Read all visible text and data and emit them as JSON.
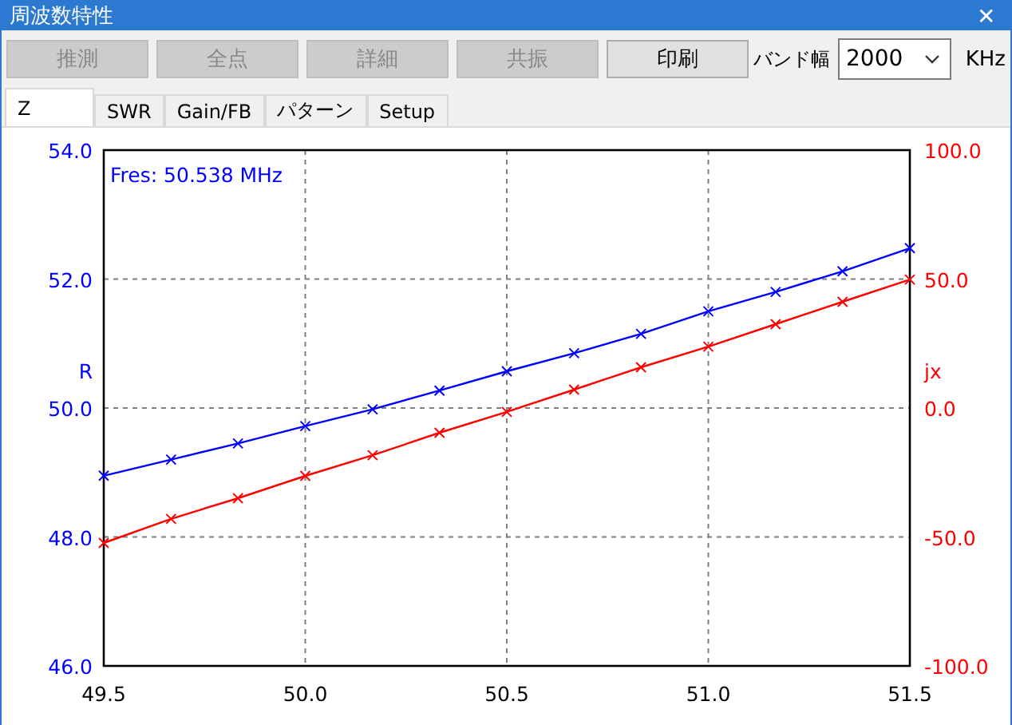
{
  "window": {
    "title": "周波数特性",
    "close": "✕"
  },
  "toolbar": {
    "buttons": [
      {
        "label": "推測",
        "disabled": true
      },
      {
        "label": "全点",
        "disabled": true
      },
      {
        "label": "詳細",
        "disabled": true
      },
      {
        "label": "共振",
        "disabled": true
      },
      {
        "label": "印刷",
        "disabled": false
      }
    ],
    "bandwidth": {
      "label": "バンド幅",
      "value": "2000",
      "unit": "KHz"
    }
  },
  "tabs": [
    {
      "label": "Z",
      "selected": true
    },
    {
      "label": "SWR",
      "selected": false
    },
    {
      "label": "Gain/FB",
      "selected": false
    },
    {
      "label": "パターン",
      "selected": false
    },
    {
      "label": "Setup",
      "selected": false
    }
  ],
  "chart_data": {
    "type": "line",
    "grid": true,
    "annotations": [
      "Fres: 50.538 MHz"
    ],
    "x": [
      49.5,
      49.667,
      49.833,
      50.0,
      50.167,
      50.333,
      50.5,
      50.667,
      50.833,
      51.0,
      51.167,
      51.333,
      51.5
    ],
    "xlim": [
      49.5,
      51.5
    ],
    "xticks": [
      {
        "value": 49.5,
        "label": "49.5"
      },
      {
        "value": 50,
        "label": "50.0"
      },
      {
        "value": 50.5,
        "label": "50.5"
      },
      {
        "value": 51,
        "label": "51.0"
      },
      {
        "value": 51.5,
        "label": "51.5"
      }
    ],
    "ylim": [
      46,
      54
    ],
    "yticks": [
      {
        "value": 46,
        "label": "46.0"
      },
      {
        "value": 48,
        "label": "48.0"
      },
      {
        "value": 50,
        "label": "50.0"
      },
      {
        "value": 52,
        "label": "52.0"
      },
      {
        "value": 54,
        "label": "54.0"
      }
    ],
    "y2lim": [
      -100,
      100
    ],
    "y2ticks": [
      {
        "value": -100,
        "label": "-100.0"
      },
      {
        "value": -50,
        "label": "-50.0"
      },
      {
        "value": 0,
        "label": "0.0"
      },
      {
        "value": 50,
        "label": "50.0"
      },
      {
        "value": 100,
        "label": "100.0"
      }
    ],
    "series": [
      {
        "name": "R",
        "color": "#0000ff",
        "marker": "x",
        "values": [
          48.95,
          49.2,
          49.45,
          49.72,
          49.98,
          50.27,
          50.57,
          50.85,
          51.15,
          51.5,
          51.8,
          52.12,
          52.48
        ]
      },
      {
        "name": "jx",
        "color": "#ff0000",
        "axis": "y2",
        "marker": "x",
        "values": [
          -52.3,
          -43,
          -35,
          -26.3,
          -18.3,
          -9.6,
          -1.5,
          7.1,
          15.8,
          23.8,
          32.5,
          41.2,
          49.8
        ]
      }
    ]
  }
}
